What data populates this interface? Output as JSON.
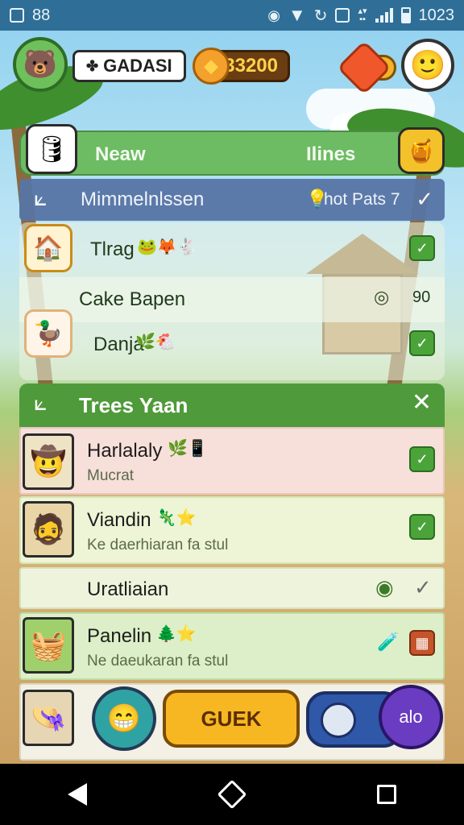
{
  "status_bar": {
    "left_text": "88",
    "time": "1023"
  },
  "hud": {
    "player_name": "GADASI",
    "coins": "33200"
  },
  "tab_bar": {
    "left_label": "Neaw",
    "right_label": "Ilines"
  },
  "sub_header": {
    "title": "Mimmelnlssen",
    "right_text": "hot Pats 7"
  },
  "ghost_rows": [
    {
      "title": "Tlrag"
    },
    {
      "title": "Cake Bapen",
      "value": "90"
    },
    {
      "title": "Danja"
    }
  ],
  "section": {
    "title": "Trees Yaan"
  },
  "list_items": [
    {
      "title": "Harlalaly",
      "subtitle": "Mucrat",
      "bg": "#f7dfda"
    },
    {
      "title": "Viandin",
      "subtitle": "Ke daerhiaran fa stul",
      "bg": "#eef5d6"
    },
    {
      "title": "Uratliaian",
      "subtitle": "",
      "bg": "#eef4dc"
    },
    {
      "title": "Panelin",
      "subtitle": "Ne daeukaran fa stul",
      "bg": "#dcefc8"
    },
    {
      "title": "",
      "subtitle": "",
      "bg": "#f3f1e5"
    }
  ],
  "action_bar": {
    "main_button": "GUEK",
    "right_button": "alo"
  },
  "icons": {
    "back": "nav-back-icon",
    "home": "nav-home-icon",
    "recent": "nav-recent-icon"
  },
  "colors": {
    "accent_green": "#4f9a3a",
    "gold": "#f7b722",
    "status_bar": "#2f6f97"
  }
}
